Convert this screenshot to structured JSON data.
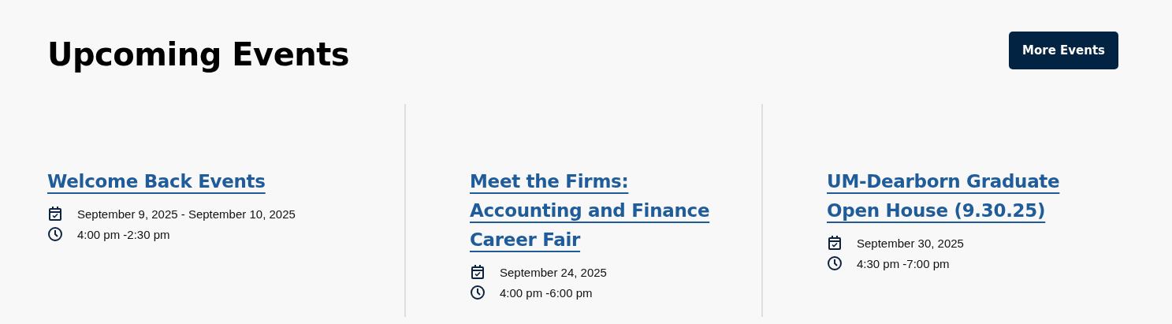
{
  "heading": "Upcoming Events",
  "more_button": "More Events",
  "events": [
    {
      "title": "Welcome Back Events",
      "date": "September 9, 2025 - September 10, 2025",
      "time": "4:00 pm -2:30 pm"
    },
    {
      "title": "Meet the Firms: Accounting and Finance Career Fair",
      "date": "September 24, 2025",
      "time": "4:00 pm -6:00 pm"
    },
    {
      "title": "UM-Dearborn Graduate Open House (9.30.25)",
      "date": "September 30, 2025",
      "time": "4:30 pm -7:00 pm"
    }
  ]
}
